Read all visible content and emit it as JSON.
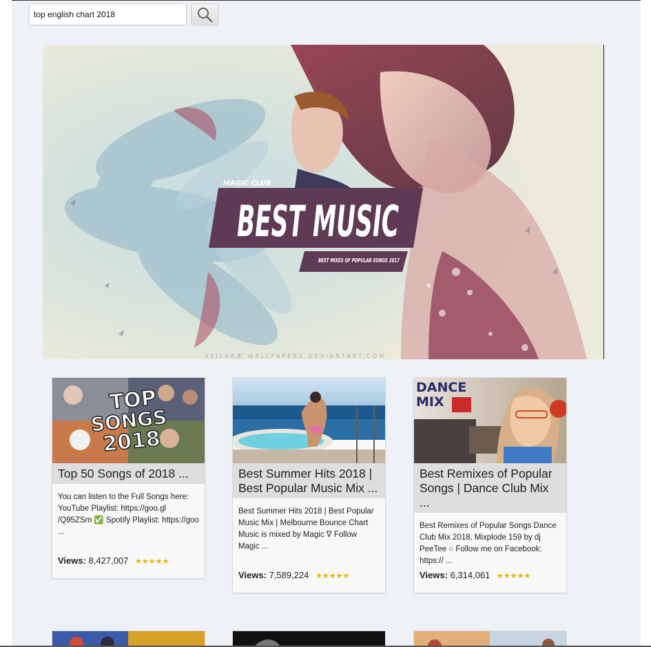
{
  "search": {
    "value": "top english chart 2018",
    "button_icon": "search-icon"
  },
  "hero": {
    "badge": "MAGIC CLUB",
    "title": "BEST MUSIC",
    "subtitle": "BEST MIXES OF POPULAR SONGS 2017",
    "watermark": "XEILARÆ WALLPAPERS.DEVIANTART.COM"
  },
  "cards": [
    {
      "title": "Top 50 Songs of 2018 ...",
      "thumb_text": [
        "TOP",
        "SONGS",
        "2018"
      ],
      "description": "You can listen to the Full Songs here: YouTube Playlist: https://goo.gl /Q95ZSm ✅ Spotify Playlist: https://goo ...",
      "views_label": "Views:",
      "views": "8,427,007",
      "rating": "★★★★★"
    },
    {
      "title": "Best Summer Hits 2018 | Best Popular Music Mix ...",
      "description": "Best Summer Hits 2018 | Best Popular Music Mix | Melbourne Bounce Chart Music is mixed by Magic ᐁ Follow Magic ...",
      "views_label": "Views:",
      "views": "7,589,224",
      "rating": "★★★★★"
    },
    {
      "title": "Best Remixes of Popular Songs | Dance Club Mix ...",
      "thumb_text": [
        "DANCE",
        "MIX"
      ],
      "description": "Best Remixes of Popular Songs Dance Club Mix 2018, Mixplode 159 by dj PeeTee ○ Follow me on Facebook: https:// ...",
      "views_label": "Views:",
      "views": "6,314,061",
      "rating": "★★★★★"
    }
  ],
  "colors": {
    "page_bg": "#eef2f7",
    "card_title_bg": "#dedede",
    "hero_banner": "#5e3a55",
    "star": "#e8b400"
  }
}
